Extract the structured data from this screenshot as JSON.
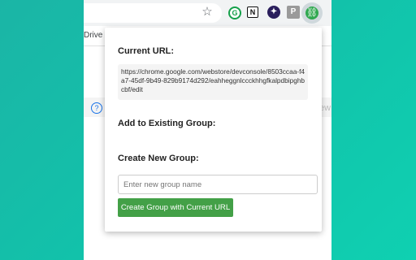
{
  "browser": {
    "bookmarks": {
      "drive_label": "Drive"
    },
    "toolbar": {
      "star_icon": "☆",
      "extensions": [
        {
          "name": "grammarly-icon",
          "glyph": "G"
        },
        {
          "name": "notion-icon",
          "glyph": "N"
        },
        {
          "name": "star-extension-icon",
          "glyph": "✦"
        },
        {
          "name": "p-extension-icon",
          "glyph": "P"
        },
        {
          "name": "link-extension-icon",
          "glyph": "⛓"
        }
      ]
    },
    "page": {
      "help_icon": "?",
      "partial_text": "ew"
    }
  },
  "popup": {
    "current_url_label": "Current URL:",
    "current_url": "https://chrome.google.com/webstore/devconsole/8503ccaa-f4a7-45df-9b49-829b9174d292/eahheggnlccckhhgfkalpdbipghbcbf/edit",
    "existing_group_label": "Add to Existing Group:",
    "new_group_label": "Create New Group:",
    "group_name_input": {
      "placeholder": "Enter new group name",
      "value": ""
    },
    "create_button_label": "Create Group with Current URL"
  },
  "colors": {
    "background": "#12c2aa",
    "button": "#43a047"
  }
}
